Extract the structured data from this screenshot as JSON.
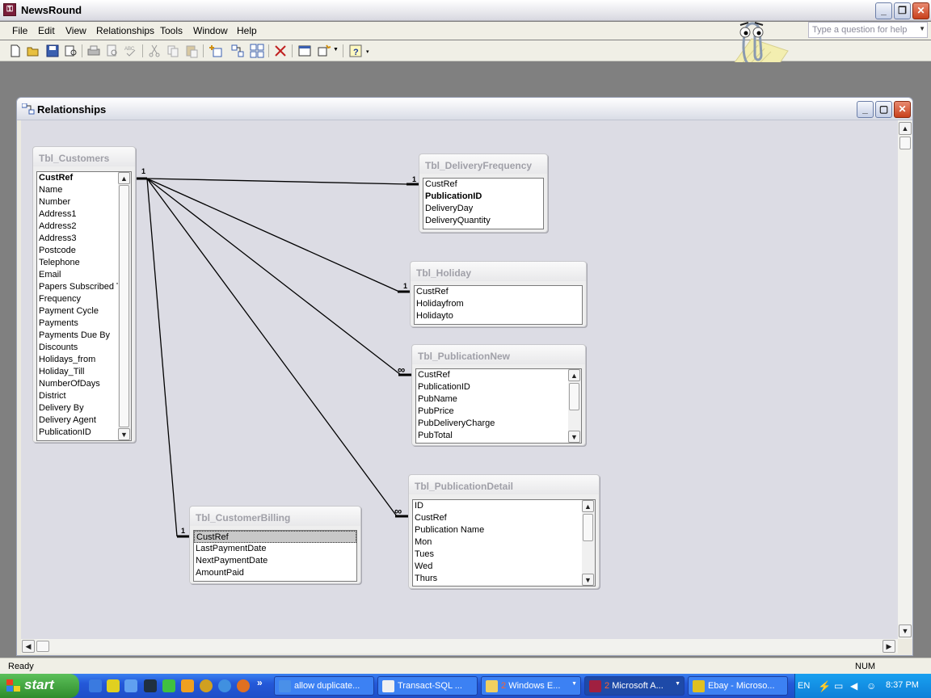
{
  "app": {
    "title": "NewsRound"
  },
  "menu": [
    "File",
    "Edit",
    "View",
    "Relationships",
    "Tools",
    "Window",
    "Help"
  ],
  "help_search": {
    "placeholder": "Type a question for help"
  },
  "window": {
    "title": "Relationships"
  },
  "tables": {
    "customers": {
      "name": "Tbl_Customers",
      "fields": [
        "CustRef",
        "Name",
        "Number",
        "Address1",
        "Address2",
        "Address3",
        "Postcode",
        "Telephone",
        "Email",
        "Papers Subscribed To",
        "Frequency",
        "Payment Cycle",
        "Payments",
        "Payments Due By",
        "Discounts",
        "Holidays_from",
        "Holiday_Till",
        "NumberOfDays",
        "District",
        "Delivery By",
        "Delivery Agent",
        "PublicationID"
      ]
    },
    "delivery_frequency": {
      "name": "Tbl_DeliveryFrequency",
      "fields": [
        "CustRef",
        "PublicationID",
        "DeliveryDay",
        "DeliveryQuantity"
      ]
    },
    "holiday": {
      "name": "Tbl_Holiday",
      "fields": [
        "CustRef",
        "Holidayfrom",
        "Holidayto"
      ]
    },
    "publication_new": {
      "name": "Tbl_PublicationNew",
      "fields": [
        "CustRef",
        "PublicationID",
        "PubName",
        "PubPrice",
        "PubDeliveryCharge",
        "PubTotal"
      ]
    },
    "publication_detail": {
      "name": "Tbl_PublicationDetail",
      "fields": [
        "ID",
        "CustRef",
        "Publication Name",
        "Mon",
        "Tues",
        "Wed",
        "Thurs"
      ]
    },
    "customer_billing": {
      "name": "Tbl_CustomerBilling",
      "fields": [
        "CustRef",
        "LastPaymentDate",
        "NextPaymentDate",
        "AmountPaid"
      ]
    }
  },
  "relationships": {
    "one_label": "1",
    "many_label": "∞"
  },
  "status": {
    "text": "Ready",
    "num": "NUM"
  },
  "taskbar": {
    "start": "start",
    "tasks": [
      {
        "label": "allow duplicate..."
      },
      {
        "label": "Transact-SQL ..."
      },
      {
        "badge": "2",
        "label": "Windows E..."
      },
      {
        "badge": "2",
        "label": "Microsoft A..."
      },
      {
        "label": "Ebay - Microso..."
      }
    ],
    "lang": "EN",
    "clock": "8:37 PM"
  }
}
